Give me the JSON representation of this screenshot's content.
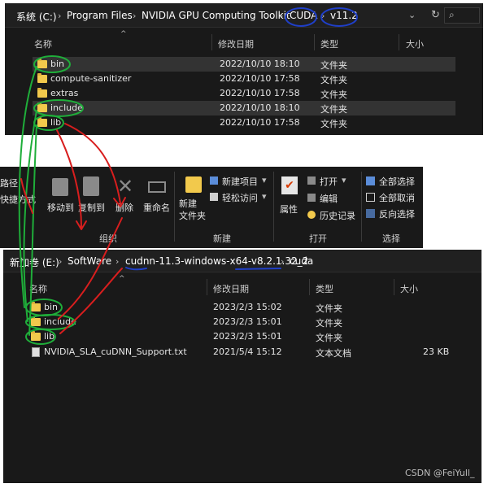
{
  "top_window": {
    "breadcrumb": [
      "系统 (C:)",
      "Program Files",
      "NVIDIA GPU Computing Toolkit",
      "CUDA",
      "v11.2"
    ],
    "columns": [
      "名称",
      "修改日期",
      "类型",
      "大小"
    ],
    "rows": [
      {
        "name": "bin",
        "date": "2022/10/10 18:10",
        "type": "文件夹",
        "selected": true
      },
      {
        "name": "compute-sanitizer",
        "date": "2022/10/10 17:58",
        "type": "文件夹",
        "selected": false
      },
      {
        "name": "extras",
        "date": "2022/10/10 17:58",
        "type": "文件夹",
        "selected": false
      },
      {
        "name": "include",
        "date": "2022/10/10 18:10",
        "type": "文件夹",
        "selected": true
      },
      {
        "name": "lib",
        "date": "2022/10/10 17:58",
        "type": "文件夹",
        "selected": false
      }
    ]
  },
  "ribbon": {
    "left_fragments": [
      "路径",
      "快捷方式"
    ],
    "organize": {
      "buttons": [
        "移动到",
        "复制到",
        "删除",
        "重命名"
      ],
      "group_label": "组织"
    },
    "new": {
      "new_folder": "新建\n文件夹",
      "new_item": "新建项目",
      "easy_access": "轻松访问",
      "group_label": "新建"
    },
    "open": {
      "properties": "属性",
      "open": "打开",
      "edit": "编辑",
      "history": "历史记录",
      "group_label": "打开"
    },
    "select": {
      "select_all": "全部选择",
      "select_none": "全部取消",
      "invert": "反向选择",
      "group_label": "选择"
    }
  },
  "bottom_window": {
    "breadcrumb": [
      "新加卷 (E:)",
      "SoftWare",
      "cudnn-11.3-windows-x64-v8.2.1.32_2",
      "cuda"
    ],
    "columns": [
      "名称",
      "修改日期",
      "类型",
      "大小"
    ],
    "rows": [
      {
        "name": "bin",
        "date": "2023/2/3 15:02",
        "type": "文件夹",
        "size": "",
        "kind": "folder"
      },
      {
        "name": "include",
        "date": "2023/2/3 15:01",
        "type": "文件夹",
        "size": "",
        "kind": "folder"
      },
      {
        "name": "lib",
        "date": "2023/2/3 15:01",
        "type": "文件夹",
        "size": "",
        "kind": "folder"
      },
      {
        "name": "NVIDIA_SLA_cuDNN_Support.txt",
        "date": "2021/5/4 15:12",
        "type": "文本文档",
        "size": "23 KB",
        "kind": "file"
      }
    ]
  },
  "watermark": "CSDN @FeiYull_",
  "colors": {
    "background": "#191919",
    "folder": "#f2c94c",
    "annotation_green": "#1fae3a",
    "annotation_red": "#d81e1e",
    "annotation_blue": "#1f3fc8"
  }
}
